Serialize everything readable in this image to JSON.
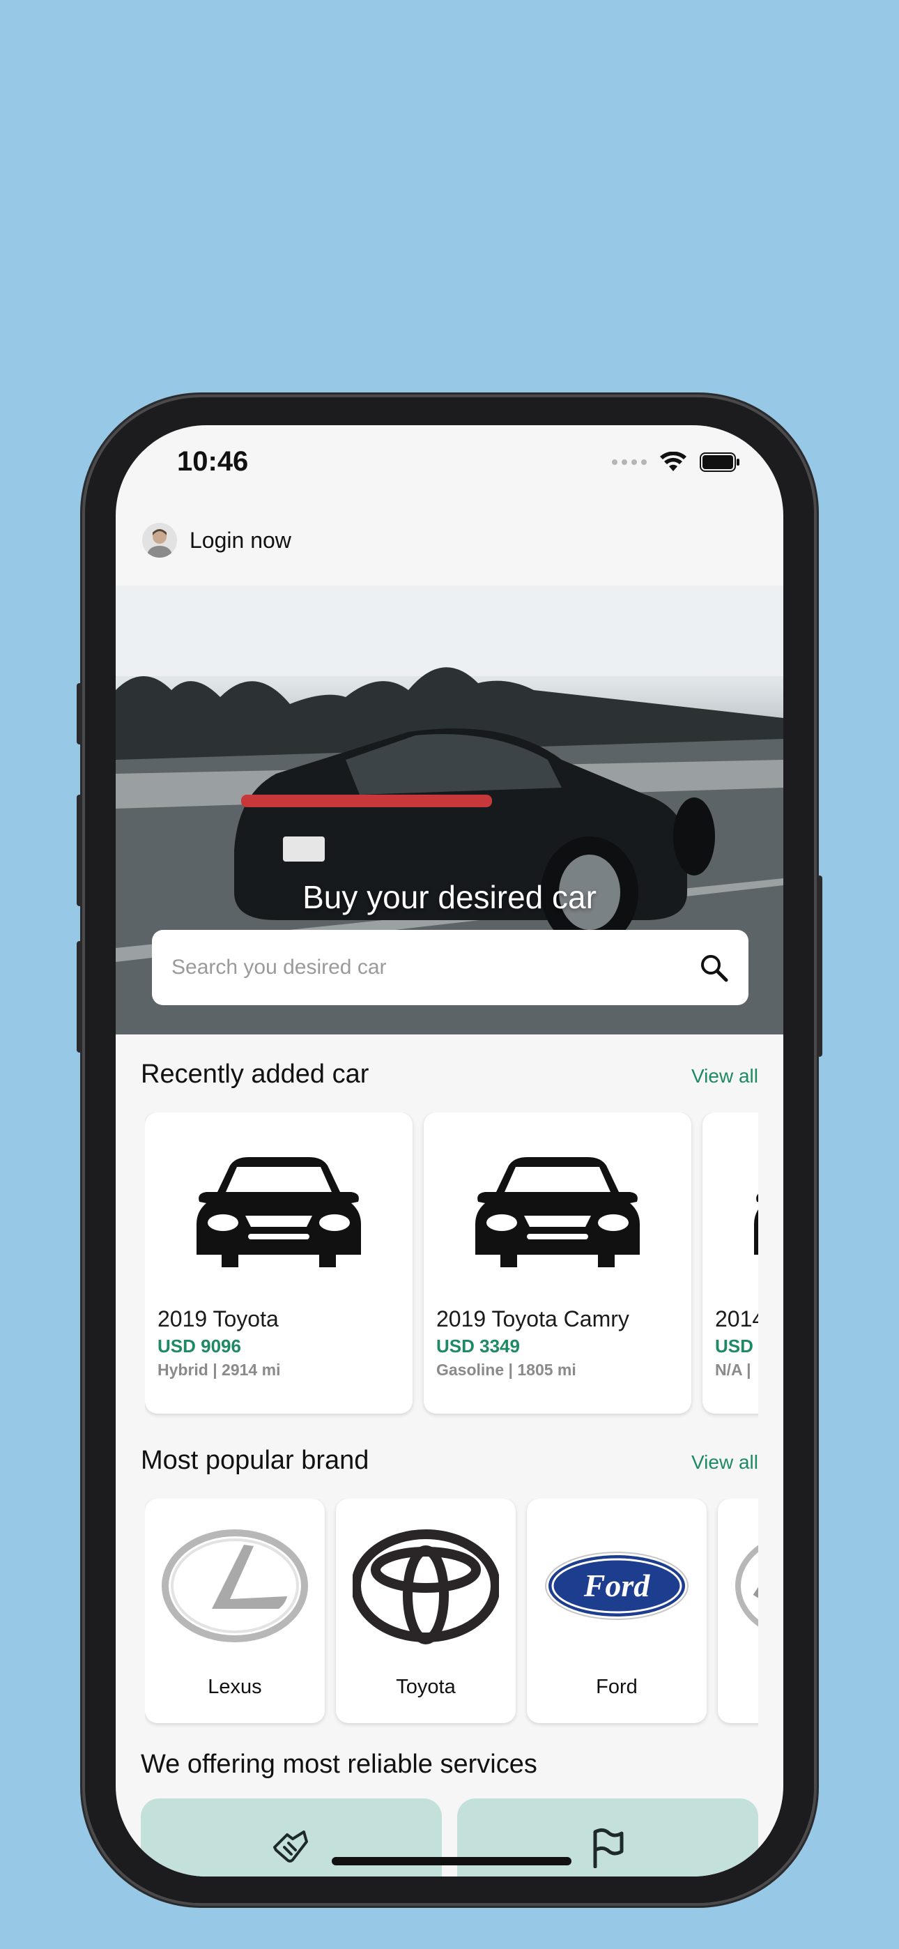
{
  "status_bar": {
    "time": "10:46"
  },
  "header": {
    "login_label": "Login now"
  },
  "hero": {
    "title": "Buy your desired car",
    "search_placeholder": "Search you desired car"
  },
  "recent": {
    "title": "Recently added car",
    "view_all": "View all",
    "cars": [
      {
        "name": "2019 Toyota",
        "price": "USD 9096",
        "meta": "Hybrid | 2914 mi"
      },
      {
        "name": "2019 Toyota Camry",
        "price": "USD 3349",
        "meta": "Gasoline | 1805 mi"
      },
      {
        "name": "2014",
        "price": "USD",
        "meta": "N/A |"
      }
    ]
  },
  "brands": {
    "title": "Most popular brand",
    "view_all": "View all",
    "items": [
      {
        "name": "Lexus"
      },
      {
        "name": "Toyota"
      },
      {
        "name": "Ford",
        "logo_text": "Ford"
      }
    ]
  },
  "services": {
    "title": "We offering most reliable services",
    "items": [
      {
        "icon": "handshake-icon"
      },
      {
        "icon": "flag-icon"
      }
    ]
  },
  "colors": {
    "accent": "#1e8a63",
    "service_card": "#c3e1da",
    "background": "#97c9e6"
  }
}
